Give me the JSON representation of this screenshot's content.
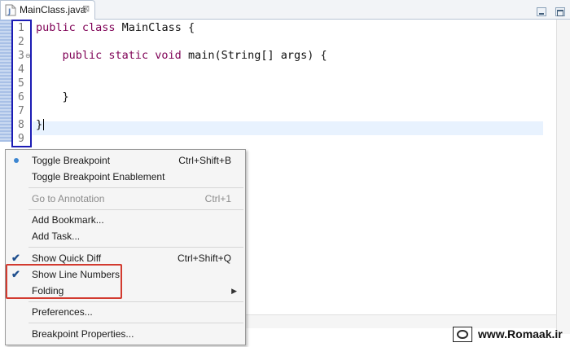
{
  "tab": {
    "title": "MainClass.java",
    "close_glyph": "⊠"
  },
  "line_numbers": [
    "1",
    "2",
    "3",
    "4",
    "5",
    "6",
    "7",
    "8",
    "9"
  ],
  "code": {
    "line1_kw": "public class",
    "line1_rest": " MainClass {",
    "line3_indent": "    ",
    "line3_kw": "public static void",
    "line3_rest": " main(String[] args) {",
    "line6": "    }",
    "line8": "}"
  },
  "context_menu": {
    "items": [
      {
        "label": "Toggle Breakpoint",
        "shortcut": "Ctrl+Shift+B"
      },
      {
        "label": "Toggle Breakpoint Enablement",
        "shortcut": ""
      },
      {
        "label": "Go to Annotation",
        "shortcut": "Ctrl+1"
      },
      {
        "label": "Add Bookmark...",
        "shortcut": ""
      },
      {
        "label": "Add Task...",
        "shortcut": ""
      },
      {
        "label": "Show Quick Diff",
        "shortcut": "Ctrl+Shift+Q"
      },
      {
        "label": "Show Line Numbers",
        "shortcut": ""
      },
      {
        "label": "Folding",
        "shortcut": ""
      },
      {
        "label": "Preferences...",
        "shortcut": ""
      },
      {
        "label": "Breakpoint Properties...",
        "shortcut": ""
      }
    ],
    "check_glyph": "✔",
    "submenu_arrow": "▶"
  },
  "watermark": {
    "text": "www.Romaak.ir"
  },
  "colors": {
    "keyword": "#7f0055",
    "line_number_highlight": "#1c1cb4",
    "menu_highlight": "#d23a2f",
    "current_line": "#e8f2fe"
  }
}
